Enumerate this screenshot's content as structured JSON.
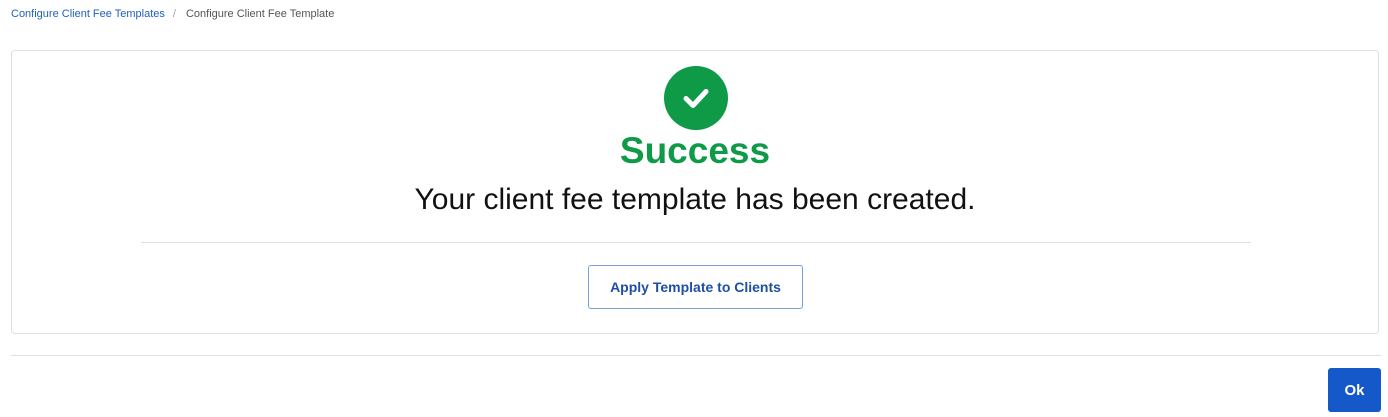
{
  "breadcrumb": {
    "parent_label": "Configure Client Fee Templates",
    "separator": "/",
    "current_label": "Configure Client Fee Template"
  },
  "confirmation": {
    "icon": "check-circle-icon",
    "title": "Success",
    "message": "Your client fee template has been created.",
    "apply_button_label": "Apply Template to Clients"
  },
  "footer": {
    "ok_label": "Ok"
  },
  "colors": {
    "success": "#0f9a48",
    "primary": "#1458c9",
    "link": "#1f5fbf",
    "border": "#dcdfe4"
  }
}
